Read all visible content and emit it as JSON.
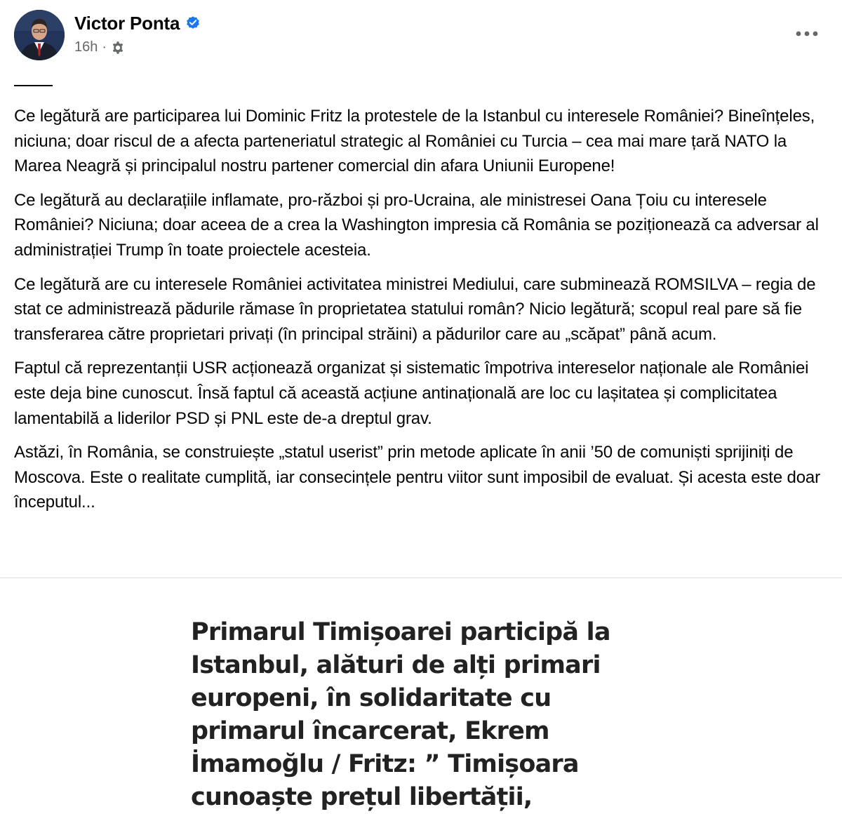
{
  "post": {
    "author": "Victor Ponta",
    "verified": true,
    "timestamp": "16h",
    "separator": "·",
    "privacy_icon": "gear-icon",
    "more_icon": "more-horizontal-icon",
    "paragraphs": [
      "Ce legătură are participarea lui Dominic Fritz la protestele de la Istanbul cu interesele României? Bineînțeles, niciuna; doar riscul de a afecta parteneriatul strategic al României cu Turcia – cea mai mare țară NATO la Marea Neagră și principalul nostru partener comercial din afara Uniunii Europene!",
      "Ce legătură au declarațiile inflamate, pro-război și pro-Ucraina, ale ministresei Oana Țoiu cu interesele României? Niciuna; doar aceea de a crea la Washington impresia că România se poziționează ca adversar al administrației Trump în toate proiectele acesteia.",
      "Ce legătură are cu interesele României activitatea ministrei Mediului, care subminează ROMSILVA – regia de stat ce administrează pădurile rămase în proprietatea statului român? Nicio legătură; scopul real pare să fie transferarea către proprietari privați (în principal străini) a pădurilor care au „scăpat” până acum.",
      "Faptul că reprezentanții USR acționează organizat și sistematic împotriva intereselor naționale ale României este deja bine cunoscut. Însă faptul că această acțiune antinațională are loc cu lașitatea și complicitatea lamentabilă a liderilor PSD și PNL este de-a dreptul grav.",
      "Astăzi, în România, se construiește „statul userist” prin metode aplicate în anii ’50 de comuniști sprijiniți de Moscova. Este o realitate cumplită, iar consecințele pentru viitor sunt imposibil de evaluat. Și acesta este doar începutul..."
    ]
  },
  "attachment": {
    "headline": "Primarul Timișoarei participă la Istanbul, alături de alți primari europeni, în solidaritate cu primarul încarcerat, Ekrem İmamoğlu / Fritz: ” Timișoara cunoaște prețul libertății,"
  },
  "colors": {
    "verified_blue": "#1877f2",
    "meta_gray": "#65676b",
    "text": "#050505"
  }
}
